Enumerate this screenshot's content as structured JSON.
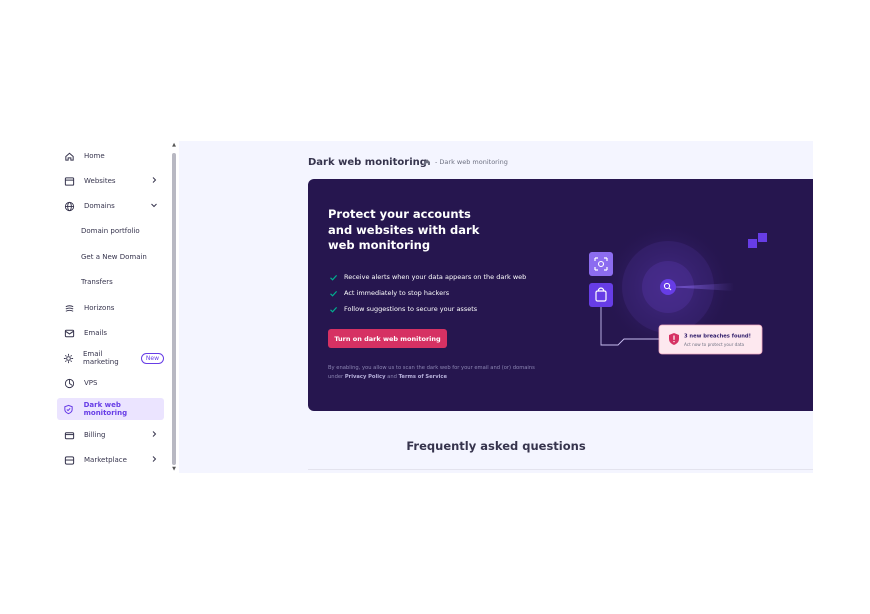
{
  "sidebar": {
    "items": [
      {
        "label": "Home",
        "icon": "home-icon"
      },
      {
        "label": "Websites",
        "icon": "websites-icon"
      },
      {
        "label": "Domains",
        "icon": "globe-icon"
      },
      {
        "label": "Domain portfolio"
      },
      {
        "label": "Get a New Domain"
      },
      {
        "label": "Transfers"
      },
      {
        "label": "Horizons",
        "icon": "horizons-icon"
      },
      {
        "label": "Emails",
        "icon": "mail-icon"
      },
      {
        "label": "Email marketing",
        "icon": "email-marketing-icon",
        "badge": "New"
      },
      {
        "label": "VPS",
        "icon": "server-icon"
      },
      {
        "label": "Dark web monitoring",
        "icon": "shield-icon"
      },
      {
        "label": "Billing",
        "icon": "billing-icon"
      },
      {
        "label": "Marketplace",
        "icon": "marketplace-icon"
      }
    ],
    "active_item": "Dark web monitoring"
  },
  "header": {
    "title": "Dark web monitoring",
    "breadcrumb": "- Dark web monitoring"
  },
  "hero": {
    "heading": "Protect your accounts and websites with dark web monitoring",
    "features": [
      "Receive alerts when your data appears on the dark web",
      "Act immediately to stop hackers",
      "Follow suggestions to secure your assets"
    ],
    "cta_label": "Turn on dark web monitoring",
    "disclaimer_prefix": "By enabling, you allow us to scan the dark web for your email and (or) domains under ",
    "privacy_policy": "Privacy Policy",
    "disclaimer_and": " and ",
    "terms": "Terms of Service",
    "alert_title": "3 new breaches found!",
    "alert_subtitle": "Act now to protect your data"
  },
  "faq": {
    "title": "Frequently asked questions"
  },
  "colors": {
    "accent": "#673de6",
    "hero_bg": "#26164f",
    "cta": "#d63163",
    "check": "#00b090"
  }
}
